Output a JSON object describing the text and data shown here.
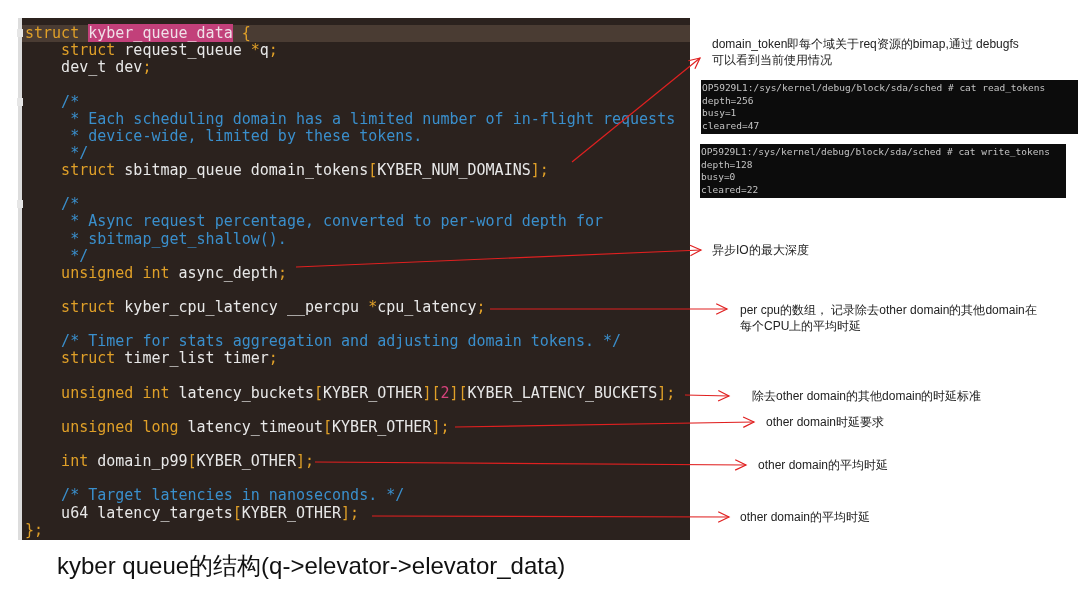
{
  "code_editor": {
    "blocks": [
      {
        "lines": [
          {
            "current": true,
            "fold": true,
            "segments": [
              {
                "kind": "kw",
                "text": "struct "
              },
              {
                "kind": "match",
                "text": "kyber_queue_data"
              },
              {
                "kind": "pu",
                "text": " {"
              }
            ]
          },
          {
            "current": false,
            "fold": false,
            "segments": [
              {
                "kind": "kw",
                "text": "    struct"
              },
              {
                "kind": "id",
                "text": " request_queue "
              },
              {
                "kind": "pu",
                "text": "*"
              },
              {
                "kind": "id",
                "text": "q"
              },
              {
                "kind": "pu",
                "text": ";"
              }
            ]
          },
          {
            "current": false,
            "fold": false,
            "segments": [
              {
                "kind": "id",
                "text": "    dev_t dev"
              },
              {
                "kind": "pu",
                "text": ";"
              }
            ]
          }
        ]
      },
      {
        "lines": [
          {
            "current": false,
            "fold": true,
            "segments": [
              {
                "kind": "cm",
                "text": "    /*"
              }
            ]
          },
          {
            "current": false,
            "fold": false,
            "segments": [
              {
                "kind": "cm",
                "text": "     * Each scheduling domain has a limited number of in-flight requests"
              }
            ]
          },
          {
            "current": false,
            "fold": false,
            "segments": [
              {
                "kind": "cm",
                "text": "     * device-wide, limited by these tokens."
              }
            ]
          },
          {
            "current": false,
            "fold": false,
            "segments": [
              {
                "kind": "cm",
                "text": "     */"
              }
            ]
          },
          {
            "current": false,
            "fold": false,
            "segments": [
              {
                "kind": "kw",
                "text": "    struct"
              },
              {
                "kind": "id",
                "text": " sbitmap_queue domain_tokens"
              },
              {
                "kind": "pu",
                "text": "["
              },
              {
                "kind": "id",
                "text": "KYBER_NUM_DOMAINS"
              },
              {
                "kind": "pu",
                "text": "];"
              }
            ]
          }
        ]
      },
      {
        "lines": [
          {
            "current": false,
            "fold": true,
            "segments": [
              {
                "kind": "cm",
                "text": "    /*"
              }
            ]
          },
          {
            "current": false,
            "fold": false,
            "segments": [
              {
                "kind": "cm",
                "text": "     * Async request percentage, converted to per-word depth for"
              }
            ]
          },
          {
            "current": false,
            "fold": false,
            "segments": [
              {
                "kind": "cm",
                "text": "     * sbitmap_get_shallow()."
              }
            ]
          },
          {
            "current": false,
            "fold": false,
            "segments": [
              {
                "kind": "cm",
                "text": "     */"
              }
            ]
          },
          {
            "current": false,
            "fold": false,
            "segments": [
              {
                "kind": "kw",
                "text": "    unsigned int"
              },
              {
                "kind": "id",
                "text": " async_depth"
              },
              {
                "kind": "pu",
                "text": ";"
              }
            ]
          }
        ]
      },
      {
        "lines": [
          {
            "current": false,
            "fold": false,
            "segments": [
              {
                "kind": "kw",
                "text": "    struct"
              },
              {
                "kind": "id",
                "text": " kyber_cpu_latency __percpu "
              },
              {
                "kind": "pu",
                "text": "*"
              },
              {
                "kind": "id",
                "text": "cpu_latency"
              },
              {
                "kind": "pu",
                "text": ";"
              }
            ]
          }
        ]
      },
      {
        "lines": [
          {
            "current": false,
            "fold": false,
            "segments": [
              {
                "kind": "cm",
                "text": "    /* Timer for stats aggregation and adjusting domain tokens. */"
              }
            ]
          },
          {
            "current": false,
            "fold": false,
            "segments": [
              {
                "kind": "kw",
                "text": "    struct"
              },
              {
                "kind": "id",
                "text": " timer_list timer"
              },
              {
                "kind": "pu",
                "text": ";"
              }
            ]
          }
        ]
      },
      {
        "lines": [
          {
            "current": false,
            "fold": false,
            "segments": [
              {
                "kind": "kw",
                "text": "    unsigned int"
              },
              {
                "kind": "id",
                "text": " latency_buckets"
              },
              {
                "kind": "pu",
                "text": "["
              },
              {
                "kind": "id",
                "text": "KYBER_OTHER"
              },
              {
                "kind": "pu",
                "text": "]["
              },
              {
                "kind": "num",
                "text": "2"
              },
              {
                "kind": "pu",
                "text": "]["
              },
              {
                "kind": "id",
                "text": "KYBER_LATENCY_BUCKETS"
              },
              {
                "kind": "pu",
                "text": "];"
              }
            ]
          }
        ]
      },
      {
        "lines": [
          {
            "current": false,
            "fold": false,
            "segments": [
              {
                "kind": "kw",
                "text": "    unsigned long"
              },
              {
                "kind": "id",
                "text": " latency_timeout"
              },
              {
                "kind": "pu",
                "text": "["
              },
              {
                "kind": "id",
                "text": "KYBER_OTHER"
              },
              {
                "kind": "pu",
                "text": "];"
              }
            ]
          }
        ]
      },
      {
        "lines": [
          {
            "current": false,
            "fold": false,
            "segments": [
              {
                "kind": "kw",
                "text": "    int"
              },
              {
                "kind": "id",
                "text": " domain_p99"
              },
              {
                "kind": "pu",
                "text": "["
              },
              {
                "kind": "id",
                "text": "KYBER_OTHER"
              },
              {
                "kind": "pu",
                "text": "];"
              }
            ]
          }
        ]
      },
      {
        "lines": [
          {
            "current": false,
            "fold": false,
            "segments": [
              {
                "kind": "cm",
                "text": "    /* Target latencies in nanoseconds. */"
              }
            ]
          },
          {
            "current": false,
            "fold": false,
            "segments": [
              {
                "kind": "id",
                "text": "    u64 latency_targets"
              },
              {
                "kind": "pu",
                "text": "["
              },
              {
                "kind": "id",
                "text": "KYBER_OTHER"
              },
              {
                "kind": "pu",
                "text": "];"
              }
            ]
          },
          {
            "current": false,
            "fold": false,
            "segments": [
              {
                "kind": "pu",
                "text": "};"
              }
            ]
          }
        ]
      }
    ]
  },
  "annotations": [
    {
      "lines": [
        "domain_token即每个域关于req资源的bimap,通过 debugfs",
        "可以看到当前使用情况"
      ]
    },
    {
      "lines": [
        "异步IO的最大深度"
      ]
    },
    {
      "lines": [
        "per cpu的数组，  记录除去other domain的其他domain在",
        "每个CPU上的平均时延"
      ]
    },
    {
      "lines": [
        "除去other domain的其他domain的时延标准"
      ]
    },
    {
      "lines": [
        "other domain时延要求"
      ]
    },
    {
      "lines": [
        "other domain的平均时延"
      ]
    },
    {
      "lines": [
        "other domain的平均时延"
      ]
    }
  ],
  "terminals": [
    {
      "lines": [
        "OP5929L1:/sys/kernel/debug/block/sda/sched # cat read_tokens",
        "depth=256",
        "busy=1",
        "cleared=47"
      ]
    },
    {
      "lines": [
        "OP5929L1:/sys/kernel/debug/block/sda/sched # cat write_tokens",
        "depth=128",
        "busy=0",
        "cleared=22"
      ]
    }
  ],
  "caption": "kyber queue的结构(q->elevator->elevator_data)"
}
